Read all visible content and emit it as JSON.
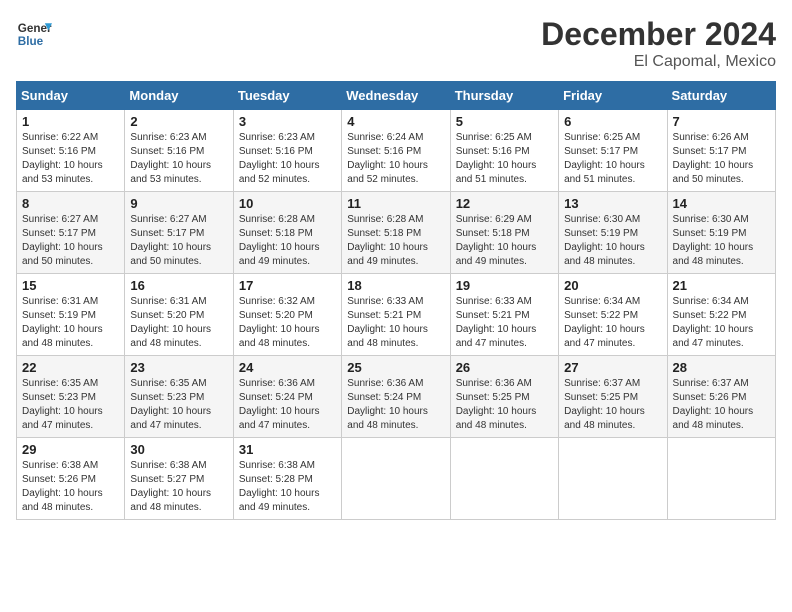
{
  "header": {
    "logo_line1": "General",
    "logo_line2": "Blue",
    "month": "December 2024",
    "location": "El Capomal, Mexico"
  },
  "columns": [
    "Sunday",
    "Monday",
    "Tuesday",
    "Wednesday",
    "Thursday",
    "Friday",
    "Saturday"
  ],
  "weeks": [
    [
      {
        "day": "1",
        "sunrise": "6:22 AM",
        "sunset": "5:16 PM",
        "daylight": "10 hours and 53 minutes."
      },
      {
        "day": "2",
        "sunrise": "6:23 AM",
        "sunset": "5:16 PM",
        "daylight": "10 hours and 53 minutes."
      },
      {
        "day": "3",
        "sunrise": "6:23 AM",
        "sunset": "5:16 PM",
        "daylight": "10 hours and 52 minutes."
      },
      {
        "day": "4",
        "sunrise": "6:24 AM",
        "sunset": "5:16 PM",
        "daylight": "10 hours and 52 minutes."
      },
      {
        "day": "5",
        "sunrise": "6:25 AM",
        "sunset": "5:16 PM",
        "daylight": "10 hours and 51 minutes."
      },
      {
        "day": "6",
        "sunrise": "6:25 AM",
        "sunset": "5:17 PM",
        "daylight": "10 hours and 51 minutes."
      },
      {
        "day": "7",
        "sunrise": "6:26 AM",
        "sunset": "5:17 PM",
        "daylight": "10 hours and 50 minutes."
      }
    ],
    [
      {
        "day": "8",
        "sunrise": "6:27 AM",
        "sunset": "5:17 PM",
        "daylight": "10 hours and 50 minutes."
      },
      {
        "day": "9",
        "sunrise": "6:27 AM",
        "sunset": "5:17 PM",
        "daylight": "10 hours and 50 minutes."
      },
      {
        "day": "10",
        "sunrise": "6:28 AM",
        "sunset": "5:18 PM",
        "daylight": "10 hours and 49 minutes."
      },
      {
        "day": "11",
        "sunrise": "6:28 AM",
        "sunset": "5:18 PM",
        "daylight": "10 hours and 49 minutes."
      },
      {
        "day": "12",
        "sunrise": "6:29 AM",
        "sunset": "5:18 PM",
        "daylight": "10 hours and 49 minutes."
      },
      {
        "day": "13",
        "sunrise": "6:30 AM",
        "sunset": "5:19 PM",
        "daylight": "10 hours and 48 minutes."
      },
      {
        "day": "14",
        "sunrise": "6:30 AM",
        "sunset": "5:19 PM",
        "daylight": "10 hours and 48 minutes."
      }
    ],
    [
      {
        "day": "15",
        "sunrise": "6:31 AM",
        "sunset": "5:19 PM",
        "daylight": "10 hours and 48 minutes."
      },
      {
        "day": "16",
        "sunrise": "6:31 AM",
        "sunset": "5:20 PM",
        "daylight": "10 hours and 48 minutes."
      },
      {
        "day": "17",
        "sunrise": "6:32 AM",
        "sunset": "5:20 PM",
        "daylight": "10 hours and 48 minutes."
      },
      {
        "day": "18",
        "sunrise": "6:33 AM",
        "sunset": "5:21 PM",
        "daylight": "10 hours and 48 minutes."
      },
      {
        "day": "19",
        "sunrise": "6:33 AM",
        "sunset": "5:21 PM",
        "daylight": "10 hours and 47 minutes."
      },
      {
        "day": "20",
        "sunrise": "6:34 AM",
        "sunset": "5:22 PM",
        "daylight": "10 hours and 47 minutes."
      },
      {
        "day": "21",
        "sunrise": "6:34 AM",
        "sunset": "5:22 PM",
        "daylight": "10 hours and 47 minutes."
      }
    ],
    [
      {
        "day": "22",
        "sunrise": "6:35 AM",
        "sunset": "5:23 PM",
        "daylight": "10 hours and 47 minutes."
      },
      {
        "day": "23",
        "sunrise": "6:35 AM",
        "sunset": "5:23 PM",
        "daylight": "10 hours and 47 minutes."
      },
      {
        "day": "24",
        "sunrise": "6:36 AM",
        "sunset": "5:24 PM",
        "daylight": "10 hours and 47 minutes."
      },
      {
        "day": "25",
        "sunrise": "6:36 AM",
        "sunset": "5:24 PM",
        "daylight": "10 hours and 48 minutes."
      },
      {
        "day": "26",
        "sunrise": "6:36 AM",
        "sunset": "5:25 PM",
        "daylight": "10 hours and 48 minutes."
      },
      {
        "day": "27",
        "sunrise": "6:37 AM",
        "sunset": "5:25 PM",
        "daylight": "10 hours and 48 minutes."
      },
      {
        "day": "28",
        "sunrise": "6:37 AM",
        "sunset": "5:26 PM",
        "daylight": "10 hours and 48 minutes."
      }
    ],
    [
      {
        "day": "29",
        "sunrise": "6:38 AM",
        "sunset": "5:26 PM",
        "daylight": "10 hours and 48 minutes."
      },
      {
        "day": "30",
        "sunrise": "6:38 AM",
        "sunset": "5:27 PM",
        "daylight": "10 hours and 48 minutes."
      },
      {
        "day": "31",
        "sunrise": "6:38 AM",
        "sunset": "5:28 PM",
        "daylight": "10 hours and 49 minutes."
      },
      null,
      null,
      null,
      null
    ]
  ]
}
